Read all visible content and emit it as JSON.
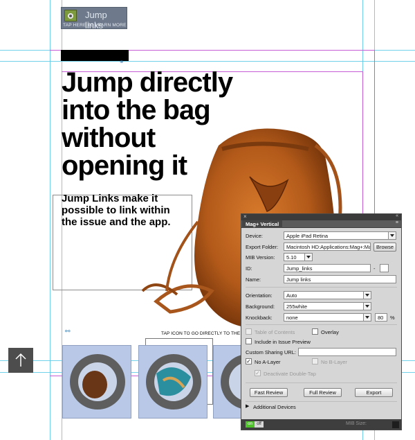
{
  "jump_badge": {
    "title": "Jump links",
    "subtitle": "TAP HERE TO LEARN MORE"
  },
  "headline": "Jump directly\ninto the bag\nwithout\nopening it",
  "body": "Jump Links make it\npossible to link within\nthe issue and the app.",
  "tap_instruction": "TAP ICON TO GO DIRECTLY TO THE",
  "icons": {
    "link": "link-icon",
    "arrow": "arrow-up-icon",
    "bag": "leather-bag-image"
  },
  "colors": {
    "guide_cyan": "#59c9e6",
    "guide_magenta": "#c65bd6",
    "panel_bg": "#d6d6d6",
    "toggle_on": "#4fc42a"
  },
  "panel": {
    "title": "Mag+ Vertical",
    "device_label": "Device:",
    "device_value": "Apple iPad Retina",
    "export_folder_label": "Export Folder:",
    "export_folder_value": "Macintosh HD:Applications:Mag+:Mag+ P",
    "browse_button": "Browse",
    "mib_version_label": "MIB Version:",
    "mib_version_value": "5.10",
    "id_label": "ID:",
    "id_value": "Jump_links",
    "id_dash": "-",
    "name_label": "Name:",
    "name_value": "Jump links",
    "orientation_label": "Orientation:",
    "orientation_value": "Auto",
    "background_label": "Background:",
    "background_value": "255white",
    "knockback_label": "Knockback:",
    "knockback_value": "none",
    "knockback_percent": "80",
    "percent_sign": "%",
    "toc_label": "Table of Contents",
    "overlay_label": "Overlay",
    "issue_preview_label": "Include in Issue Preview",
    "custom_sharing_label": "Custom Sharing URL:",
    "no_a_layer_label": "No A-Layer",
    "no_b_layer_label": "No B-Layer",
    "deactivate_double_tap_label": "Deactivate Double-Tap",
    "fast_review_button": "Fast Review",
    "full_review_button": "Full Review",
    "export_button": "Export",
    "additional_devices_label": "Additional Devices",
    "toggle_on": "on",
    "toggle_off": "off",
    "mib_size_label": "MIB Size:"
  }
}
